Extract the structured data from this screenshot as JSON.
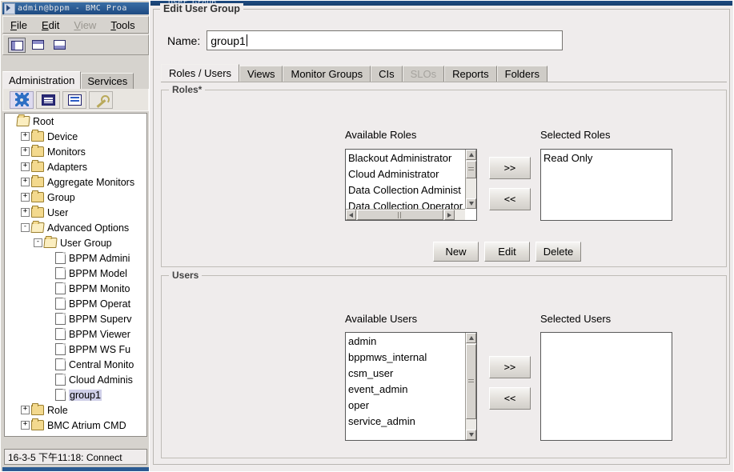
{
  "app": {
    "title": "admin@bppm - BMC Proa",
    "title_icon": "app-icon",
    "menu": [
      {
        "label": "File",
        "mnemonic": "F",
        "disabled": false
      },
      {
        "label": "Edit",
        "mnemonic": "E",
        "disabled": false
      },
      {
        "label": "View",
        "mnemonic": "V",
        "disabled": true
      },
      {
        "label": "Tools",
        "mnemonic": "T",
        "disabled": false
      }
    ],
    "toolbar_buttons": [
      {
        "name": "layout-left-split-button",
        "selected": true
      },
      {
        "name": "layout-top-split-button",
        "selected": false
      },
      {
        "name": "layout-bottom-split-button",
        "selected": false
      }
    ],
    "tabs": [
      {
        "label": "Administration",
        "active": true
      },
      {
        "label": "Services",
        "active": false
      }
    ],
    "icon_buttons": [
      {
        "name": "gear-icon",
        "selected": true
      },
      {
        "name": "console-window-icon",
        "selected": false
      },
      {
        "name": "list-view-icon",
        "selected": false
      },
      {
        "name": "wrench-icon",
        "selected": false
      }
    ],
    "status": "16-3-5 下午11:18: Connect"
  },
  "tree": [
    {
      "label": "Root",
      "depth": 0,
      "expander": "none",
      "icon": "folder-open",
      "selected": false
    },
    {
      "label": "Device",
      "depth": 1,
      "expander": "+",
      "icon": "folder",
      "selected": false
    },
    {
      "label": "Monitors",
      "depth": 1,
      "expander": "+",
      "icon": "folder",
      "selected": false
    },
    {
      "label": "Adapters",
      "depth": 1,
      "expander": "+",
      "icon": "folder",
      "selected": false
    },
    {
      "label": "Aggregate Monitors",
      "depth": 1,
      "expander": "+",
      "icon": "folder",
      "selected": false
    },
    {
      "label": "Group",
      "depth": 1,
      "expander": "+",
      "icon": "folder",
      "selected": false
    },
    {
      "label": "User",
      "depth": 1,
      "expander": "+",
      "icon": "folder",
      "selected": false
    },
    {
      "label": "Advanced Options",
      "depth": 1,
      "expander": "-",
      "icon": "folder-open",
      "selected": false
    },
    {
      "label": "User Group",
      "depth": 2,
      "expander": "-",
      "icon": "folder-open",
      "selected": false
    },
    {
      "label": "BPPM Admini",
      "depth": 3,
      "expander": "none",
      "icon": "file",
      "selected": false
    },
    {
      "label": "BPPM Model ",
      "depth": 3,
      "expander": "none",
      "icon": "file",
      "selected": false
    },
    {
      "label": "BPPM Monito",
      "depth": 3,
      "expander": "none",
      "icon": "file",
      "selected": false
    },
    {
      "label": "BPPM Operat",
      "depth": 3,
      "expander": "none",
      "icon": "file",
      "selected": false
    },
    {
      "label": "BPPM Superv",
      "depth": 3,
      "expander": "none",
      "icon": "file",
      "selected": false
    },
    {
      "label": "BPPM Viewer",
      "depth": 3,
      "expander": "none",
      "icon": "file",
      "selected": false
    },
    {
      "label": "BPPM WS Fu",
      "depth": 3,
      "expander": "none",
      "icon": "file",
      "selected": false
    },
    {
      "label": "Central Monito",
      "depth": 3,
      "expander": "none",
      "icon": "file",
      "selected": false
    },
    {
      "label": "Cloud Adminis",
      "depth": 3,
      "expander": "none",
      "icon": "file",
      "selected": false
    },
    {
      "label": "group1",
      "depth": 3,
      "expander": "none",
      "icon": "file",
      "selected": true
    },
    {
      "label": "Role",
      "depth": 1,
      "expander": "+",
      "icon": "folder",
      "selected": false
    },
    {
      "label": "BMC Atrium CMD",
      "depth": 1,
      "expander": "+",
      "icon": "folder",
      "selected": false
    }
  ],
  "dialog": {
    "window_title": "User Group",
    "legend": "Edit User Group",
    "name_label": "Name:",
    "name_value": "group1",
    "name_placeholder": "",
    "tabs": [
      {
        "label": "Roles / Users",
        "active": true,
        "disabled": false
      },
      {
        "label": "Views",
        "active": false,
        "disabled": false
      },
      {
        "label": "Monitor Groups",
        "active": false,
        "disabled": false
      },
      {
        "label": "CIs",
        "active": false,
        "disabled": false
      },
      {
        "label": "SLOs",
        "active": false,
        "disabled": true
      },
      {
        "label": "Reports",
        "active": false,
        "disabled": false
      },
      {
        "label": "Folders",
        "active": false,
        "disabled": false
      }
    ],
    "roles": {
      "legend": "Roles*",
      "available_label": "Available Roles",
      "selected_label": "Selected Roles",
      "available": [
        "Blackout Administrator",
        "Cloud Administrator",
        "Data Collection Administ",
        "Data Collection Operator"
      ],
      "selected": [
        "Read Only"
      ],
      "add_button": ">>",
      "remove_button": "<<",
      "actions": [
        {
          "label": "New",
          "name": "new-role-button"
        },
        {
          "label": "Edit",
          "name": "edit-role-button"
        },
        {
          "label": "Delete",
          "name": "delete-role-button"
        }
      ]
    },
    "users": {
      "legend": "Users",
      "available_label": "Available Users",
      "selected_label": "Selected Users",
      "available": [
        "admin",
        "bppmws_internal",
        "csm_user",
        "event_admin",
        "oper",
        "service_admin"
      ],
      "selected": [],
      "add_button": ">>",
      "remove_button": "<<"
    }
  },
  "colors": {
    "titlebar": "#1e4a80",
    "face": "#efecec",
    "app_face": "#d6d3ce",
    "selection": "#cfcfe8",
    "accent": "#2d6fc4"
  }
}
